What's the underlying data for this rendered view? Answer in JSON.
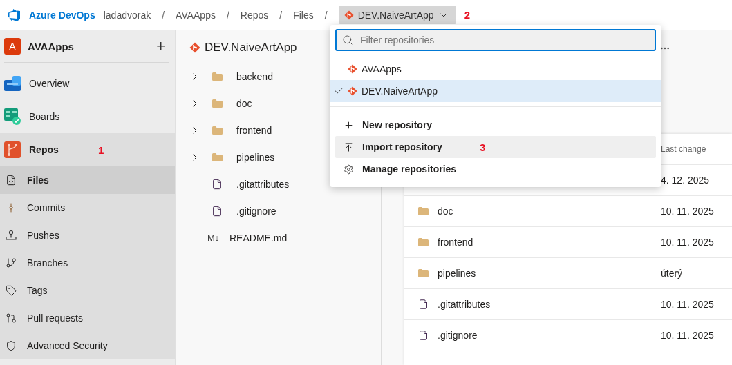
{
  "topbar": {
    "product": "Azure DevOps",
    "breadcrumb": [
      {
        "kind": "crumb",
        "text": "ladadvorak"
      },
      {
        "kind": "separator",
        "text": "/"
      },
      {
        "kind": "crumb",
        "text": "AVAApps"
      },
      {
        "kind": "separator",
        "text": "/"
      },
      {
        "kind": "crumb",
        "text": "Repos"
      },
      {
        "kind": "separator",
        "text": "/"
      },
      {
        "kind": "crumb",
        "text": "Files"
      },
      {
        "kind": "separator",
        "text": "/"
      }
    ],
    "repo_picker": {
      "label": "DEV.NaiveArtApp",
      "expanded": true,
      "annotation": "2"
    }
  },
  "sidebar": {
    "project": {
      "initial": "A",
      "name": "AVAApps",
      "add": "+"
    },
    "items": [
      {
        "kind": "overview",
        "label": "Overview",
        "expanded": false
      },
      {
        "kind": "boards",
        "label": "Boards",
        "expanded": false
      },
      {
        "kind": "repos",
        "label": "Repos",
        "expanded": true,
        "annotation": "1",
        "children": [
          {
            "kind": "files",
            "label": "Files",
            "selected": true
          },
          {
            "kind": "commits",
            "label": "Commits",
            "selected": false
          },
          {
            "kind": "pushes",
            "label": "Pushes",
            "selected": false
          },
          {
            "kind": "branches",
            "label": "Branches",
            "selected": false
          },
          {
            "kind": "tags",
            "label": "Tags",
            "selected": false
          },
          {
            "kind": "pulls",
            "label": "Pull requests",
            "selected": false
          },
          {
            "kind": "security",
            "label": "Advanced Security",
            "selected": false
          }
        ]
      }
    ]
  },
  "tree": {
    "title": "DEV.NaiveArtApp",
    "items": [
      {
        "kind": "folder",
        "name": "backend"
      },
      {
        "kind": "folder",
        "name": "doc"
      },
      {
        "kind": "folder",
        "name": "frontend"
      },
      {
        "kind": "folder",
        "name": "pipelines"
      },
      {
        "kind": "file",
        "name": ".gitattributes"
      },
      {
        "kind": "file",
        "name": ".gitignore"
      },
      {
        "kind": "markdown",
        "name": "README.md",
        "badge": "M↓"
      }
    ]
  },
  "table": {
    "columns": [
      "Last change"
    ],
    "rows": [
      {
        "last_change": "4. 12. 2025"
      },
      {
        "kind": "folder",
        "name": "doc",
        "last_change": "10. 11. 2025"
      },
      {
        "kind": "folder",
        "name": "frontend",
        "last_change": "10. 11. 2025"
      },
      {
        "kind": "folder",
        "name": "pipelines",
        "last_change": "úterý"
      },
      {
        "kind": "file",
        "name": ".gitattributes",
        "last_change": "10. 11. 2025"
      },
      {
        "kind": "file",
        "name": ".gitignore",
        "last_change": "10. 11. 2025"
      }
    ]
  },
  "dropdown": {
    "search": {
      "placeholder": "Filter repositories"
    },
    "repos": [
      {
        "name": "AVAApps",
        "selected": false
      },
      {
        "name": "DEV.NaiveArtApp",
        "selected": true
      }
    ],
    "actions": [
      {
        "kind": "new",
        "label": "New repository",
        "highlighted": false
      },
      {
        "kind": "import",
        "label": "Import repository",
        "highlighted": true,
        "annotation": "3"
      },
      {
        "kind": "manage",
        "label": "Manage repositories",
        "highlighted": false
      }
    ]
  }
}
